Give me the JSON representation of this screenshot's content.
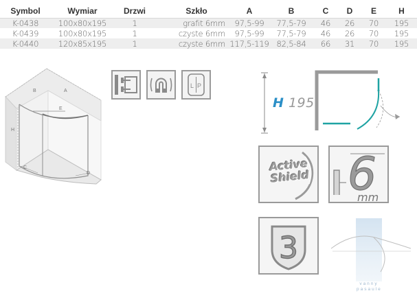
{
  "table": {
    "headers": [
      "Symbol",
      "Wymiar",
      "Drzwi",
      "Szkło",
      "A",
      "B",
      "C",
      "D",
      "E",
      "H"
    ],
    "rows": [
      [
        "K-0438",
        "100x80x195",
        "1",
        "grafit 6mm",
        "97,5-99",
        "77,5-79",
        "46",
        "26",
        "70",
        "195"
      ],
      [
        "K-0439",
        "100x80x195",
        "1",
        "czyste 6mm",
        "97,5-99",
        "77,5-79",
        "46",
        "26",
        "70",
        "195"
      ],
      [
        "K-0440",
        "120x85x195",
        "1",
        "czyste 6mm",
        "117,5-119",
        "82,5-84",
        "66",
        "31",
        "70",
        "195"
      ]
    ]
  },
  "diagram_labels": {
    "a": "A",
    "b": "B",
    "e": "E",
    "h": "H",
    "c": "C",
    "d": "D"
  },
  "features": {
    "height_letter": "H",
    "height_value": "195",
    "glass_mm": "mm",
    "glass_number": "6",
    "coating_line1": "Active",
    "coating_line2": "Shield",
    "warranty_number": "3",
    "reversible_l": "L",
    "reversible_p": "P",
    "brand_line1": "vanny",
    "brand_line2": "pasaule"
  },
  "colors": {
    "accent_blue": "#2b8fc7",
    "tile_border": "#9a9a9a",
    "door_teal": "#1fa3a3"
  }
}
